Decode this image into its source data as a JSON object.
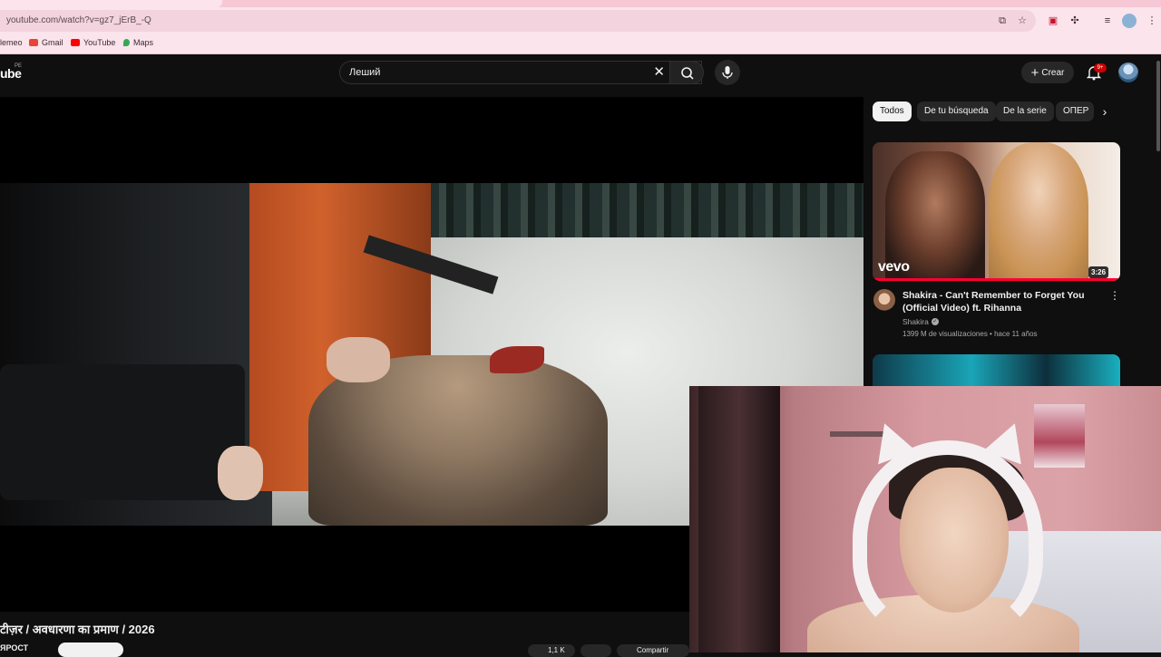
{
  "browser": {
    "url": "youtube.com/watch?v=gz7_jErB_-Q",
    "bookmarks": [
      {
        "label": "lemeo"
      },
      {
        "label": "Gmail"
      },
      {
        "label": "YouTube"
      },
      {
        "label": "Maps"
      }
    ]
  },
  "header": {
    "logo_text": "ube",
    "country_code": "PE",
    "search_query": "Леший",
    "create_label": "Crear",
    "notifications_badge": "9+"
  },
  "video": {
    "title": "टीज़र / अवधारणा का प्रमाण / 2026",
    "channel": "ЯРОСТ",
    "like_count": "1,1 K",
    "share_label": "Compartir"
  },
  "sidebar": {
    "chips": [
      {
        "label": "Todos",
        "active": true
      },
      {
        "label": "De tu búsqueda",
        "active": false
      },
      {
        "label": "De la serie",
        "active": false
      },
      {
        "label": "ОПЕР",
        "active": false
      }
    ],
    "recommended": [
      {
        "title": "Shakira - Can't Remember to Forget You (Official Video) ft. Rihanna",
        "channel": "Shakira",
        "meta": "1399 M de visualizaciones • hace 11 años",
        "duration": "3:26",
        "watermark": "vevo"
      }
    ]
  },
  "colors": {
    "browser_bg": "#fbe4eb",
    "yt_bg": "#0f0f0f",
    "progress_red": "#ff0033",
    "badge_red": "#cc0000"
  },
  "icons": [
    "install-icon",
    "star-icon",
    "extension-icon",
    "puzzle-icon",
    "queue-icon",
    "profile-icon",
    "clear-icon",
    "search-icon",
    "mic-icon",
    "plus-icon",
    "bell-icon",
    "chevron-right-icon",
    "kebab-icon",
    "verified-icon",
    "like-icon",
    "share-icon"
  ]
}
